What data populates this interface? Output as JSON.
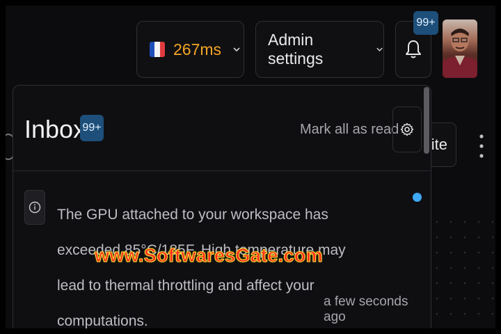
{
  "header": {
    "latency": "267ms",
    "admin_settings_label": "Admin settings",
    "notification_count": "99+"
  },
  "background": {
    "write_button_label": "rite"
  },
  "inbox": {
    "title": "Inbox",
    "count_badge": "99+",
    "mark_all_read": "Mark all as read",
    "notifications": [
      {
        "text": "The GPU attached to your workspace has exceeded 85°C/185F. High temperature may lead to thermal throttling and affect your computations.",
        "time": "a few seconds ago",
        "unread": true
      }
    ]
  },
  "watermark": "www.SoftwaresGate.com",
  "colors": {
    "accent_latency": "#f5a524",
    "badge_bg": "#1d4f7a",
    "unread_dot": "#3fa9f5"
  }
}
